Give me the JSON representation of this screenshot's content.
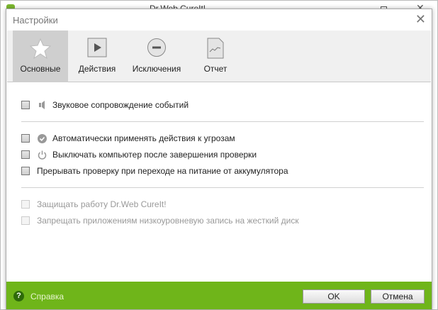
{
  "background_window": {
    "title": "Dr.Web CureIt!"
  },
  "dialog": {
    "title": "Настройки",
    "tabs": [
      {
        "label": "Основные",
        "icon": "star-icon",
        "selected": true
      },
      {
        "label": "Действия",
        "icon": "play-icon"
      },
      {
        "label": "Исключения",
        "icon": "minus-circle-icon"
      },
      {
        "label": "Отчет",
        "icon": "report-icon"
      }
    ],
    "options": [
      {
        "label": "Звуковое сопровождение событий",
        "icon": "speaker-icon",
        "checked": false
      },
      {
        "label": "Автоматически применять действия к угрозам",
        "icon": "check-circle-icon",
        "checked": false
      },
      {
        "label": "Выключать компьютер после завершения проверки",
        "icon": "power-icon",
        "checked": false
      },
      {
        "label": "Прерывать проверку при переходе на питание от аккумулятора",
        "checked": false
      },
      {
        "label": "Защищать работу Dr.Web CureIt!",
        "checked": false,
        "disabled": true
      },
      {
        "label": "Запрещать приложениям низкоуровневую запись на жесткий диск",
        "checked": false,
        "disabled": true
      }
    ],
    "footer": {
      "help": "Справка",
      "ok": "OK",
      "cancel": "Отмена",
      "color": "#6fb51a"
    }
  }
}
